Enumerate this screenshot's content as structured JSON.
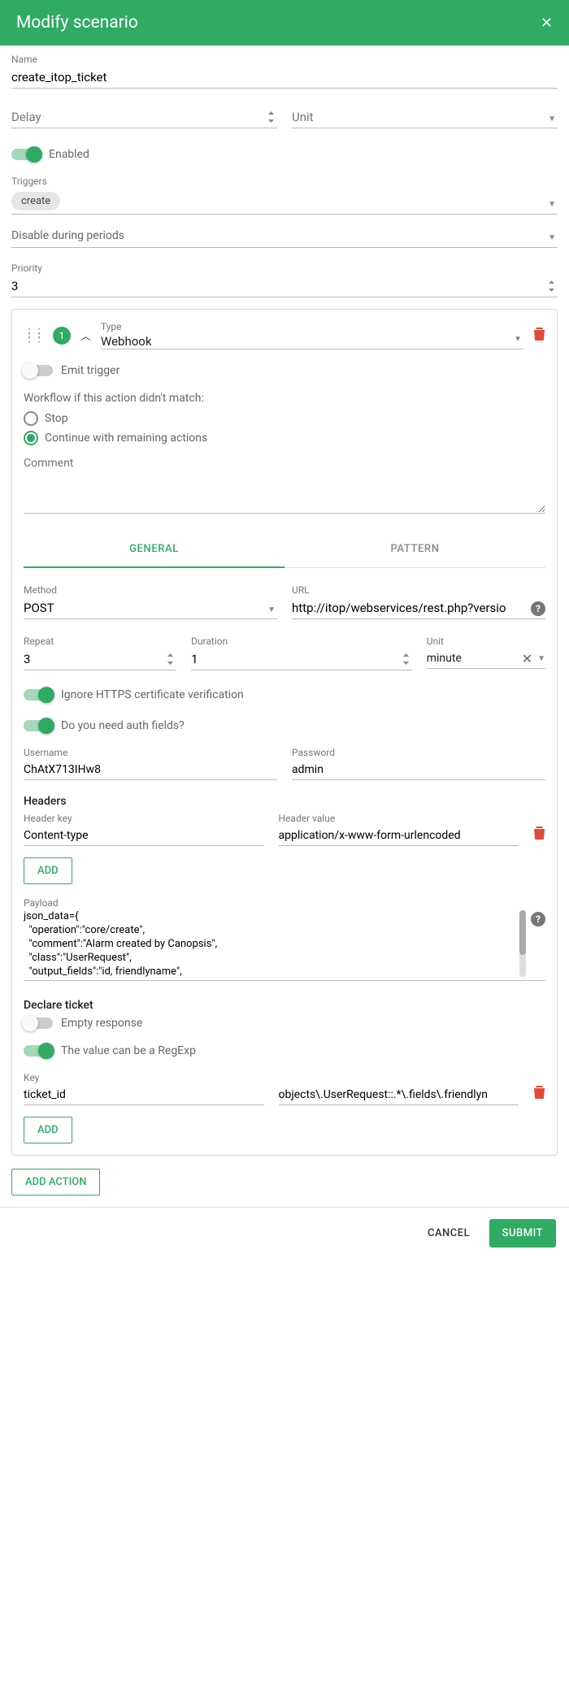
{
  "header": {
    "title": "Modify scenario"
  },
  "fields": {
    "name_label": "Name",
    "name_value": "create_itop_ticket",
    "delay_label": "Delay",
    "delay_value": "",
    "unit_label": "Unit",
    "unit_value": "",
    "enabled_label": "Enabled",
    "triggers_label": "Triggers",
    "trigger_chip": "create",
    "disable_periods_label": "Disable during periods",
    "priority_label": "Priority",
    "priority_value": "3"
  },
  "action": {
    "number": "1",
    "type_label": "Type",
    "type_value": "Webhook",
    "emit_trigger_label": "Emit trigger",
    "workflow_heading": "Workflow if this action didn't match:",
    "stop_label": "Stop",
    "continue_label": "Continue with remaining actions",
    "comment_label": "Comment",
    "tabs": {
      "general": "GENERAL",
      "pattern": "PATTERN"
    },
    "method_label": "Method",
    "method_value": "POST",
    "url_label": "URL",
    "url_value": "http://itop/webservices/rest.php?versio",
    "repeat_label": "Repeat",
    "repeat_value": "3",
    "duration_label": "Duration",
    "duration_value": "1",
    "dur_unit_label": "Unit",
    "dur_unit_value": "minute",
    "ignore_https_label": "Ignore HTTPS certificate verification",
    "auth_fields_label": "Do you need auth fields?",
    "username_label": "Username",
    "username_value": "ChAtX713IHw8",
    "password_label": "Password",
    "password_value": "admin",
    "headers_heading": "Headers",
    "header_key_label": "Header key",
    "header_key_value": "Content-type",
    "header_value_label": "Header value",
    "header_value_value": "application/x-www-form-urlencoded",
    "add_label": "ADD",
    "payload_label": "Payload",
    "payload_value": "json_data={\n  \"operation\":\"core/create\",\n  \"comment\":\"Alarm created by Canopsis\",\n  \"class\":\"UserRequest\",\n  \"output_fields\":\"id, friendlyname\",\n  \"fields\":",
    "declare_heading": "Declare ticket",
    "empty_response_label": "Empty response",
    "regexp_label": "The value can be a RegExp",
    "key_label": "Key",
    "key_value": "ticket_id",
    "key_path_value": "objects\\.UserRequest::.*\\.fields\\.friendlyn"
  },
  "add_action_label": "ADD ACTION",
  "footer": {
    "cancel": "CANCEL",
    "submit": "SUBMIT"
  }
}
